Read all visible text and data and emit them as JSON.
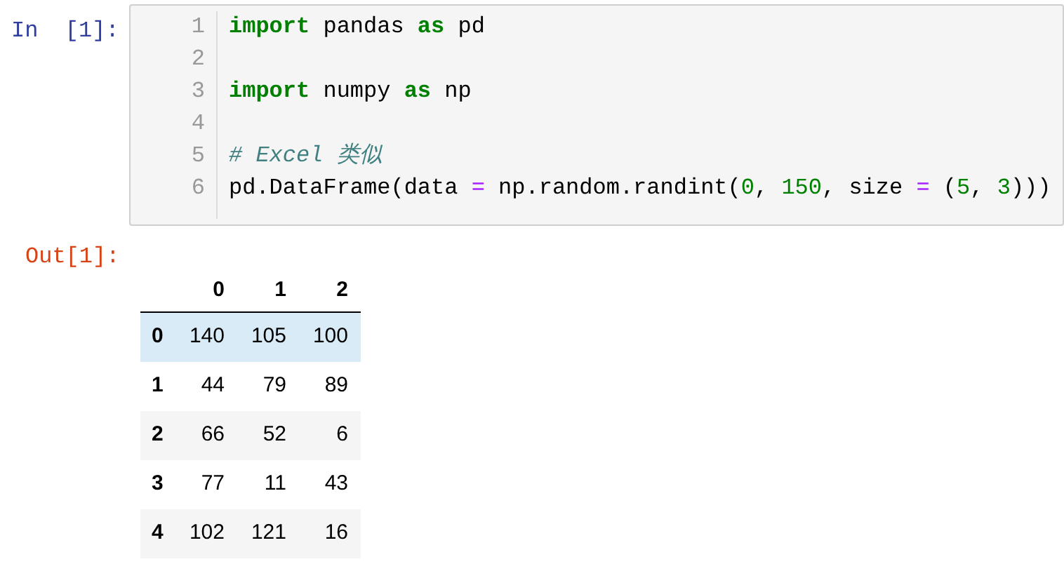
{
  "input_cell": {
    "prompt": "In  [1]:",
    "lines": [
      {
        "number": "1",
        "tokens": [
          {
            "kind": "keyword",
            "text": "import"
          },
          {
            "kind": "plain",
            "text": " pandas "
          },
          {
            "kind": "keyword",
            "text": "as"
          },
          {
            "kind": "plain",
            "text": " pd"
          }
        ]
      },
      {
        "number": "2"
      },
      {
        "number": "3",
        "tokens": [
          {
            "kind": "keyword",
            "text": "import"
          },
          {
            "kind": "plain",
            "text": " numpy "
          },
          {
            "kind": "keyword",
            "text": "as"
          },
          {
            "kind": "plain",
            "text": " np"
          }
        ]
      },
      {
        "number": "4"
      },
      {
        "number": "5",
        "tokens": [
          {
            "kind": "comment",
            "text": "# Excel 类似"
          }
        ]
      },
      {
        "number": "6",
        "tokens": [
          {
            "kind": "plain",
            "text": "pd.DataFrame(data "
          },
          {
            "kind": "operator",
            "text": "="
          },
          {
            "kind": "plain",
            "text": " np.random.randint("
          },
          {
            "kind": "number",
            "text": "0"
          },
          {
            "kind": "plain",
            "text": ", "
          },
          {
            "kind": "number",
            "text": "150"
          },
          {
            "kind": "plain",
            "text": ", size "
          },
          {
            "kind": "operator",
            "text": "="
          },
          {
            "kind": "plain",
            "text": " ("
          },
          {
            "kind": "number",
            "text": "5"
          },
          {
            "kind": "plain",
            "text": ", "
          },
          {
            "kind": "number",
            "text": "3"
          },
          {
            "kind": "plain",
            "text": ")))"
          }
        ]
      }
    ]
  },
  "output_cell": {
    "prompt": "Out[1]:",
    "table": {
      "columns": [
        "0",
        "1",
        "2"
      ],
      "rows": [
        {
          "index": "0",
          "cells": [
            "140",
            "105",
            "100"
          ],
          "selected": true
        },
        {
          "index": "1",
          "cells": [
            "44",
            "79",
            "89"
          ],
          "selected": false
        },
        {
          "index": "2",
          "cells": [
            "66",
            "52",
            "6"
          ],
          "selected": false
        },
        {
          "index": "3",
          "cells": [
            "77",
            "11",
            "43"
          ],
          "selected": false
        },
        {
          "index": "4",
          "cells": [
            "102",
            "121",
            "16"
          ],
          "selected": false
        }
      ]
    }
  }
}
